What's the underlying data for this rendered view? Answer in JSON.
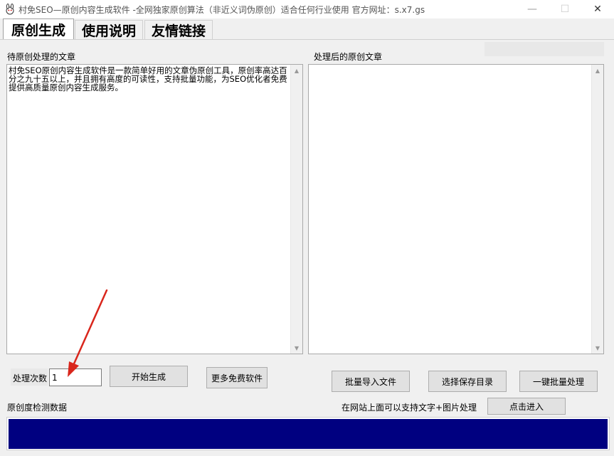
{
  "window": {
    "title": "村免SEO—原创内容生成软件 -全网独家原创算法（非近义词伪原创）适合任何行业使用 官方网址：s.x7.gs",
    "minimize_glyph": "—",
    "maximize_glyph": "☐",
    "close_glyph": "✕"
  },
  "tabs": [
    {
      "label": "原创生成"
    },
    {
      "label": "使用说明"
    },
    {
      "label": "友情链接"
    }
  ],
  "source": {
    "label": "待原创处理的文章",
    "text": "村免SEO原创内容生成软件是一款简单好用的文章伪原创工具，原创率高达百分之九十五以上，并且拥有高度的可读性，支持批量功能，为SEO优化者免费提供高质量原创内容生成服务。"
  },
  "output": {
    "label": "处理后的原创文章",
    "text": ""
  },
  "controls": {
    "count_label": "处理次数",
    "count_value": "1",
    "start_button": "开始生成",
    "more_button": "更多免费软件",
    "batch_import_button": "批量导入文件",
    "choose_dir_button": "选择保存目录",
    "batch_process_button": "一键批量处理"
  },
  "footer": {
    "detect_label": "原创度检测数据",
    "site_note": "在网站上面可以支持文字+图片处理",
    "enter_button": "点击进入"
  },
  "progress": {
    "fraction": 1.0,
    "color": "#000080"
  },
  "annotation": {
    "arrow_color": "#d9261c"
  }
}
